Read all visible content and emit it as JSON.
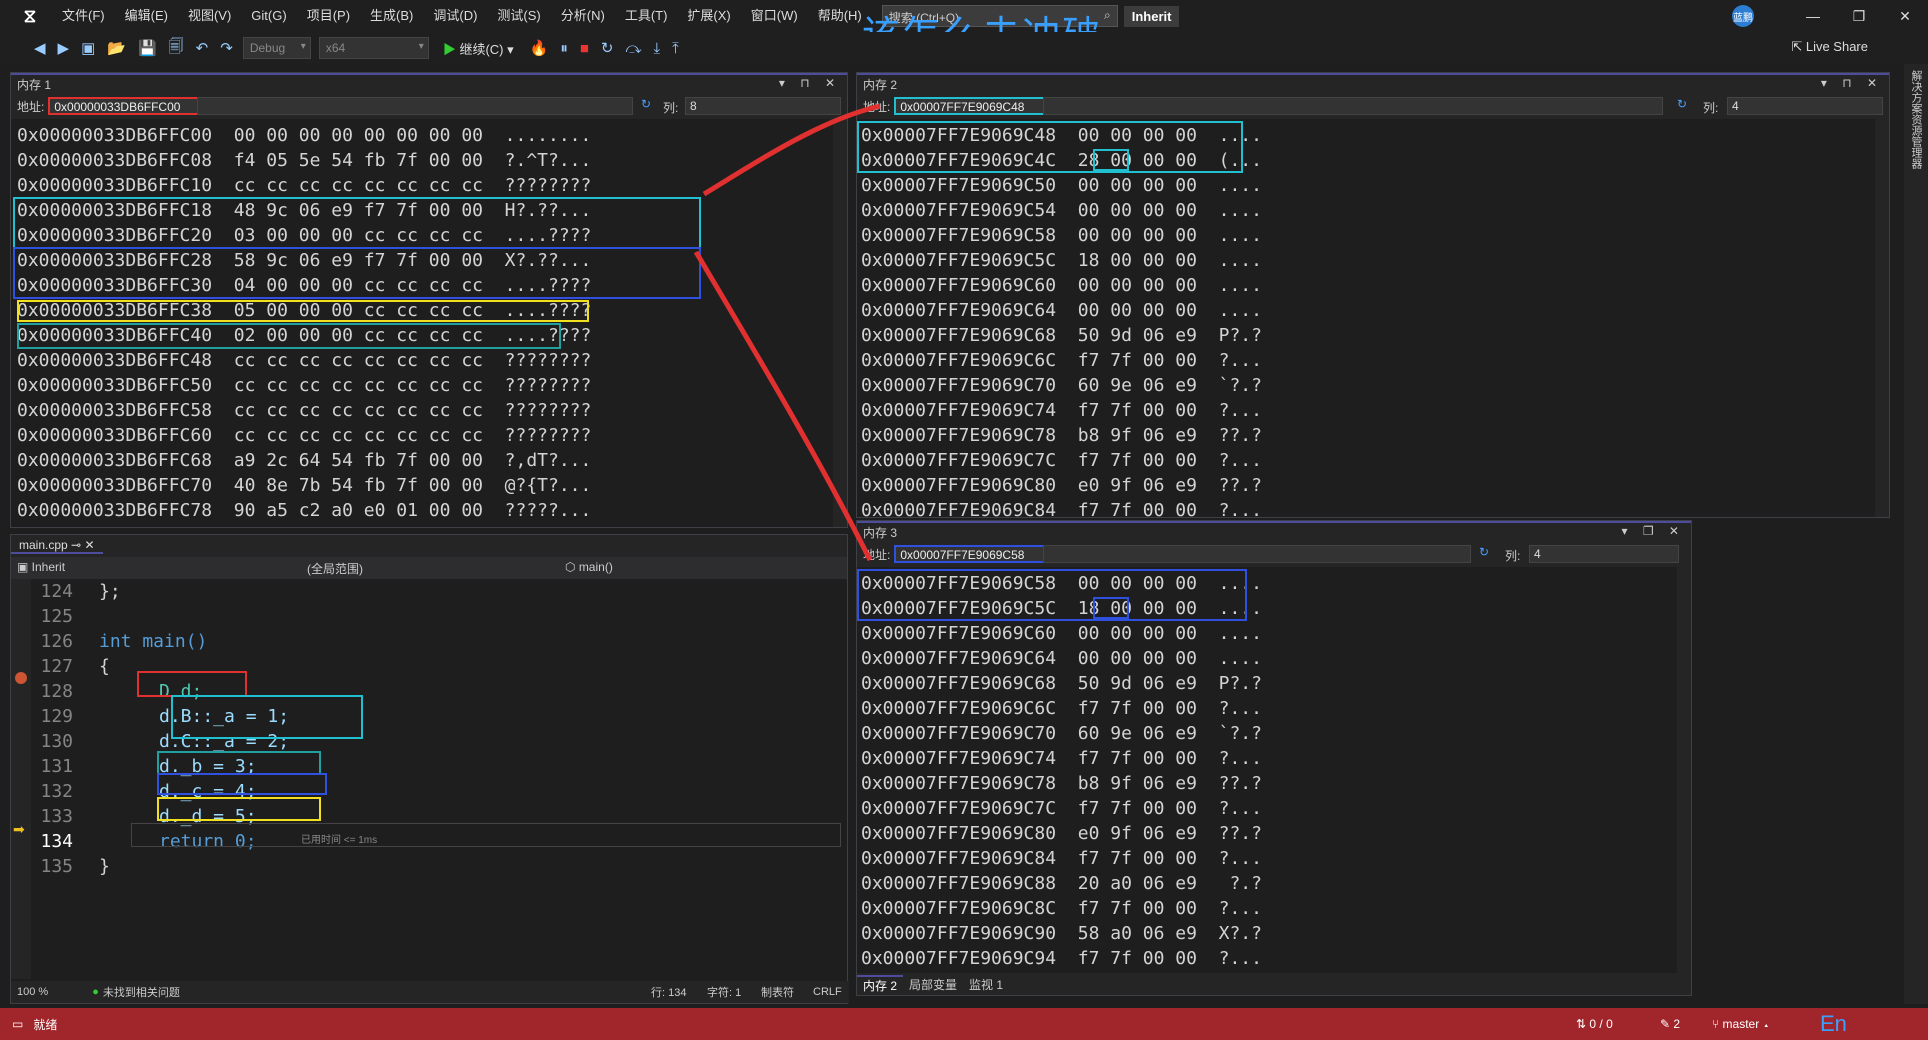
{
  "menubar": {
    "items": [
      "文件(F)",
      "编辑(E)",
      "视图(V)",
      "Git(G)",
      "项目(P)",
      "生成(B)",
      "调试(D)",
      "测试(S)",
      "分析(N)",
      "工具(T)",
      "扩展(X)",
      "窗口(W)",
      "帮助(H)"
    ],
    "search_placeholder": "搜索 (Ctrl+Q)",
    "solution_name": "Inherit",
    "overlay_title": "该怎么去冲破",
    "avatar": "蓝鹏"
  },
  "toolbar": {
    "config": "Debug",
    "platform": "x64",
    "continue_label": "继续(C)",
    "liveshare": "Live Share"
  },
  "side_tab": "解决方案资源管理器",
  "mem1": {
    "title": "内存 1",
    "addr_label": "地址:",
    "address": "0x00000033DB6FFC00",
    "col_label": "列:",
    "cols": "8",
    "rows": [
      "0x00000033DB6FFC00  00 00 00 00 00 00 00 00  ........",
      "0x00000033DB6FFC08  f4 05 5e 54 fb 7f 00 00  ?.^T?...",
      "0x00000033DB6FFC10  cc cc cc cc cc cc cc cc  ????????",
      "0x00000033DB6FFC18  48 9c 06 e9 f7 7f 00 00  H?.??...",
      "0x00000033DB6FFC20  03 00 00 00 cc cc cc cc  ....????",
      "0x00000033DB6FFC28  58 9c 06 e9 f7 7f 00 00  X?.??...",
      "0x00000033DB6FFC30  04 00 00 00 cc cc cc cc  ....????",
      "0x00000033DB6FFC38  05 00 00 00 cc cc cc cc  ....????",
      "0x00000033DB6FFC40  02 00 00 00 cc cc cc cc  ....????",
      "0x00000033DB6FFC48  cc cc cc cc cc cc cc cc  ????????",
      "0x00000033DB6FFC50  cc cc cc cc cc cc cc cc  ????????",
      "0x00000033DB6FFC58  cc cc cc cc cc cc cc cc  ????????",
      "0x00000033DB6FFC60  cc cc cc cc cc cc cc cc  ????????",
      "0x00000033DB6FFC68  a9 2c 64 54 fb 7f 00 00  ?,dT?...",
      "0x00000033DB6FFC70  40 8e 7b 54 fb 7f 00 00  @?{T?...",
      "0x00000033DB6FFC78  90 a5 c2 a0 e0 01 00 00  ?????..."
    ]
  },
  "mem2": {
    "title": "内存 2",
    "addr_label": "地址:",
    "address": "0x00007FF7E9069C48",
    "col_label": "列:",
    "cols": "4",
    "rows": [
      "0x00007FF7E9069C48  00 00 00 00  ....",
      "0x00007FF7E9069C4C  28 00 00 00  (...",
      "0x00007FF7E9069C50  00 00 00 00  ....",
      "0x00007FF7E9069C54  00 00 00 00  ....",
      "0x00007FF7E9069C58  00 00 00 00  ....",
      "0x00007FF7E9069C5C  18 00 00 00  ....",
      "0x00007FF7E9069C60  00 00 00 00  ....",
      "0x00007FF7E9069C64  00 00 00 00  ....",
      "0x00007FF7E9069C68  50 9d 06 e9  P?.?",
      "0x00007FF7E9069C6C  f7 7f 00 00  ?...",
      "0x00007FF7E9069C70  60 9e 06 e9  `?.?",
      "0x00007FF7E9069C74  f7 7f 00 00  ?...",
      "0x00007FF7E9069C78  b8 9f 06 e9  ??.?",
      "0x00007FF7E9069C7C  f7 7f 00 00  ?...",
      "0x00007FF7E9069C80  e0 9f 06 e9  ??.?",
      "0x00007FF7E9069C84  f7 7f 00 00  ?..."
    ]
  },
  "mem3": {
    "title": "内存 3",
    "addr_label": "地址:",
    "address": "0x00007FF7E9069C58",
    "col_label": "列:",
    "cols": "4",
    "rows": [
      "0x00007FF7E9069C58  00 00 00 00  ....",
      "0x00007FF7E9069C5C  18 00 00 00  ....",
      "0x00007FF7E9069C60  00 00 00 00  ....",
      "0x00007FF7E9069C64  00 00 00 00  ....",
      "0x00007FF7E9069C68  50 9d 06 e9  P?.?",
      "0x00007FF7E9069C6C  f7 7f 00 00  ?...",
      "0x00007FF7E9069C70  60 9e 06 e9  `?.?",
      "0x00007FF7E9069C74  f7 7f 00 00  ?...",
      "0x00007FF7E9069C78  b8 9f 06 e9  ??.?",
      "0x00007FF7E9069C7C  f7 7f 00 00  ?...",
      "0x00007FF7E9069C80  e0 9f 06 e9  ??.?",
      "0x00007FF7E9069C84  f7 7f 00 00  ?...",
      "0x00007FF7E9069C88  20 a0 06 e9   ?.?",
      "0x00007FF7E9069C8C  f7 7f 00 00  ?...",
      "0x00007FF7E9069C90  58 a0 06 e9  X?.?",
      "0x00007FF7E9069C94  f7 7f 00 00  ?..."
    ],
    "bottom_tabs": [
      "内存 2",
      "局部变量",
      "监视 1"
    ]
  },
  "editor": {
    "tab": "main.cpp",
    "project": "Inherit",
    "scope": "(全局范围)",
    "func": "main()",
    "lines": [
      {
        "n": "124",
        "t": "};"
      },
      {
        "n": "125",
        "t": ""
      },
      {
        "n": "126",
        "t": "int main()"
      },
      {
        "n": "127",
        "t": "{"
      },
      {
        "n": "128",
        "t": "D d;"
      },
      {
        "n": "129",
        "t": "d.B::_a = 1;"
      },
      {
        "n": "130",
        "t": "d.C::_a = 2;"
      },
      {
        "n": "131",
        "t": "d._b = 3;"
      },
      {
        "n": "132",
        "t": "d._c = 4;"
      },
      {
        "n": "133",
        "t": "d._d = 5;"
      },
      {
        "n": "134",
        "t": "return 0;"
      },
      {
        "n": "135",
        "t": "}"
      }
    ],
    "elapsed": "已用时间 <= 1ms",
    "zoom": "100 %",
    "issues": "未找到相关问题",
    "pos_line": "行: 134",
    "pos_char": "字符: 1",
    "tabs_mode": "制表符",
    "eol": "CRLF"
  },
  "status": {
    "ready": "就绪",
    "sync": "0 / 0",
    "edits": "2",
    "branch": "master",
    "ime": "En"
  },
  "colors": {
    "red": "#e03030",
    "cyan": "#20c0d0",
    "blue": "#3050e0",
    "yellow": "#f0e020",
    "status": "#a1262b"
  }
}
